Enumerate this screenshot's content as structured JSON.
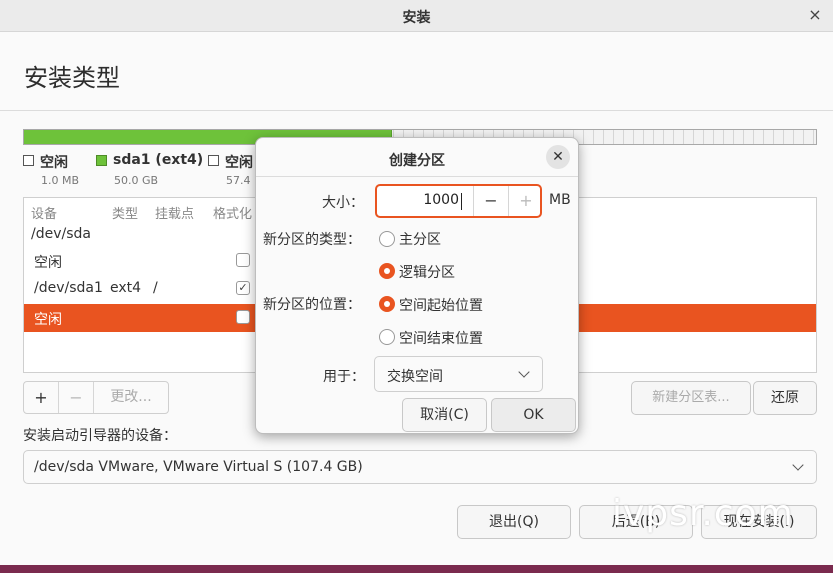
{
  "window": {
    "title": "安装",
    "close_glyph": "×"
  },
  "page": {
    "title": "安装类型"
  },
  "colors": {
    "accent": "#e95420",
    "partition_used": "#6ec23a"
  },
  "partition_bar": {
    "used_fraction": 0.465
  },
  "legend": [
    {
      "name": "空闲",
      "size": "1.0 MB",
      "swatch": "empty"
    },
    {
      "name": "sda1 (ext4)",
      "size": "50.0 GB",
      "swatch": "green"
    },
    {
      "name": "空闲",
      "size": "57.4",
      "swatch": "empty"
    }
  ],
  "table": {
    "headers": {
      "device": "设备",
      "type": "类型",
      "mount": "挂载点",
      "format": "格式化"
    },
    "rows": [
      {
        "device": "/dev/sda",
        "type": "",
        "mount": "",
        "format": null,
        "selected": false
      },
      {
        "device": "空闲",
        "type": "",
        "mount": "",
        "format": false,
        "selected": false
      },
      {
        "device": "/dev/sda1",
        "type": "ext4",
        "mount": "/",
        "format": true,
        "selected": false
      },
      {
        "device": "空闲",
        "type": "",
        "mount": "",
        "format": false,
        "selected": true
      }
    ]
  },
  "toolbar": {
    "add": "+",
    "remove": "−",
    "change": "更改..."
  },
  "buttons": {
    "new_table": "新建分区表...",
    "revert": "还原",
    "quit": "退出(Q)",
    "back": "后退(B)",
    "install_now": "现在安装(I)"
  },
  "boot": {
    "label": "安装启动引导器的设备：",
    "value": "/dev/sda   VMware, VMware Virtual S (107.4 GB)"
  },
  "dialog": {
    "title": "创建分区",
    "size_label": "大小：",
    "size_value": "1000",
    "size_unit": "MB",
    "minus": "−",
    "plus": "+",
    "type_label": "新分区的类型：",
    "type_primary": "主分区",
    "type_logical": "逻辑分区",
    "location_label": "新分区的位置：",
    "loc_start": "空间起始位置",
    "loc_end": "空间结束位置",
    "use_label": "用于：",
    "use_value": "交换空间",
    "cancel": "取消(C)",
    "ok": "OK"
  },
  "watermark": "ivpsr.com"
}
